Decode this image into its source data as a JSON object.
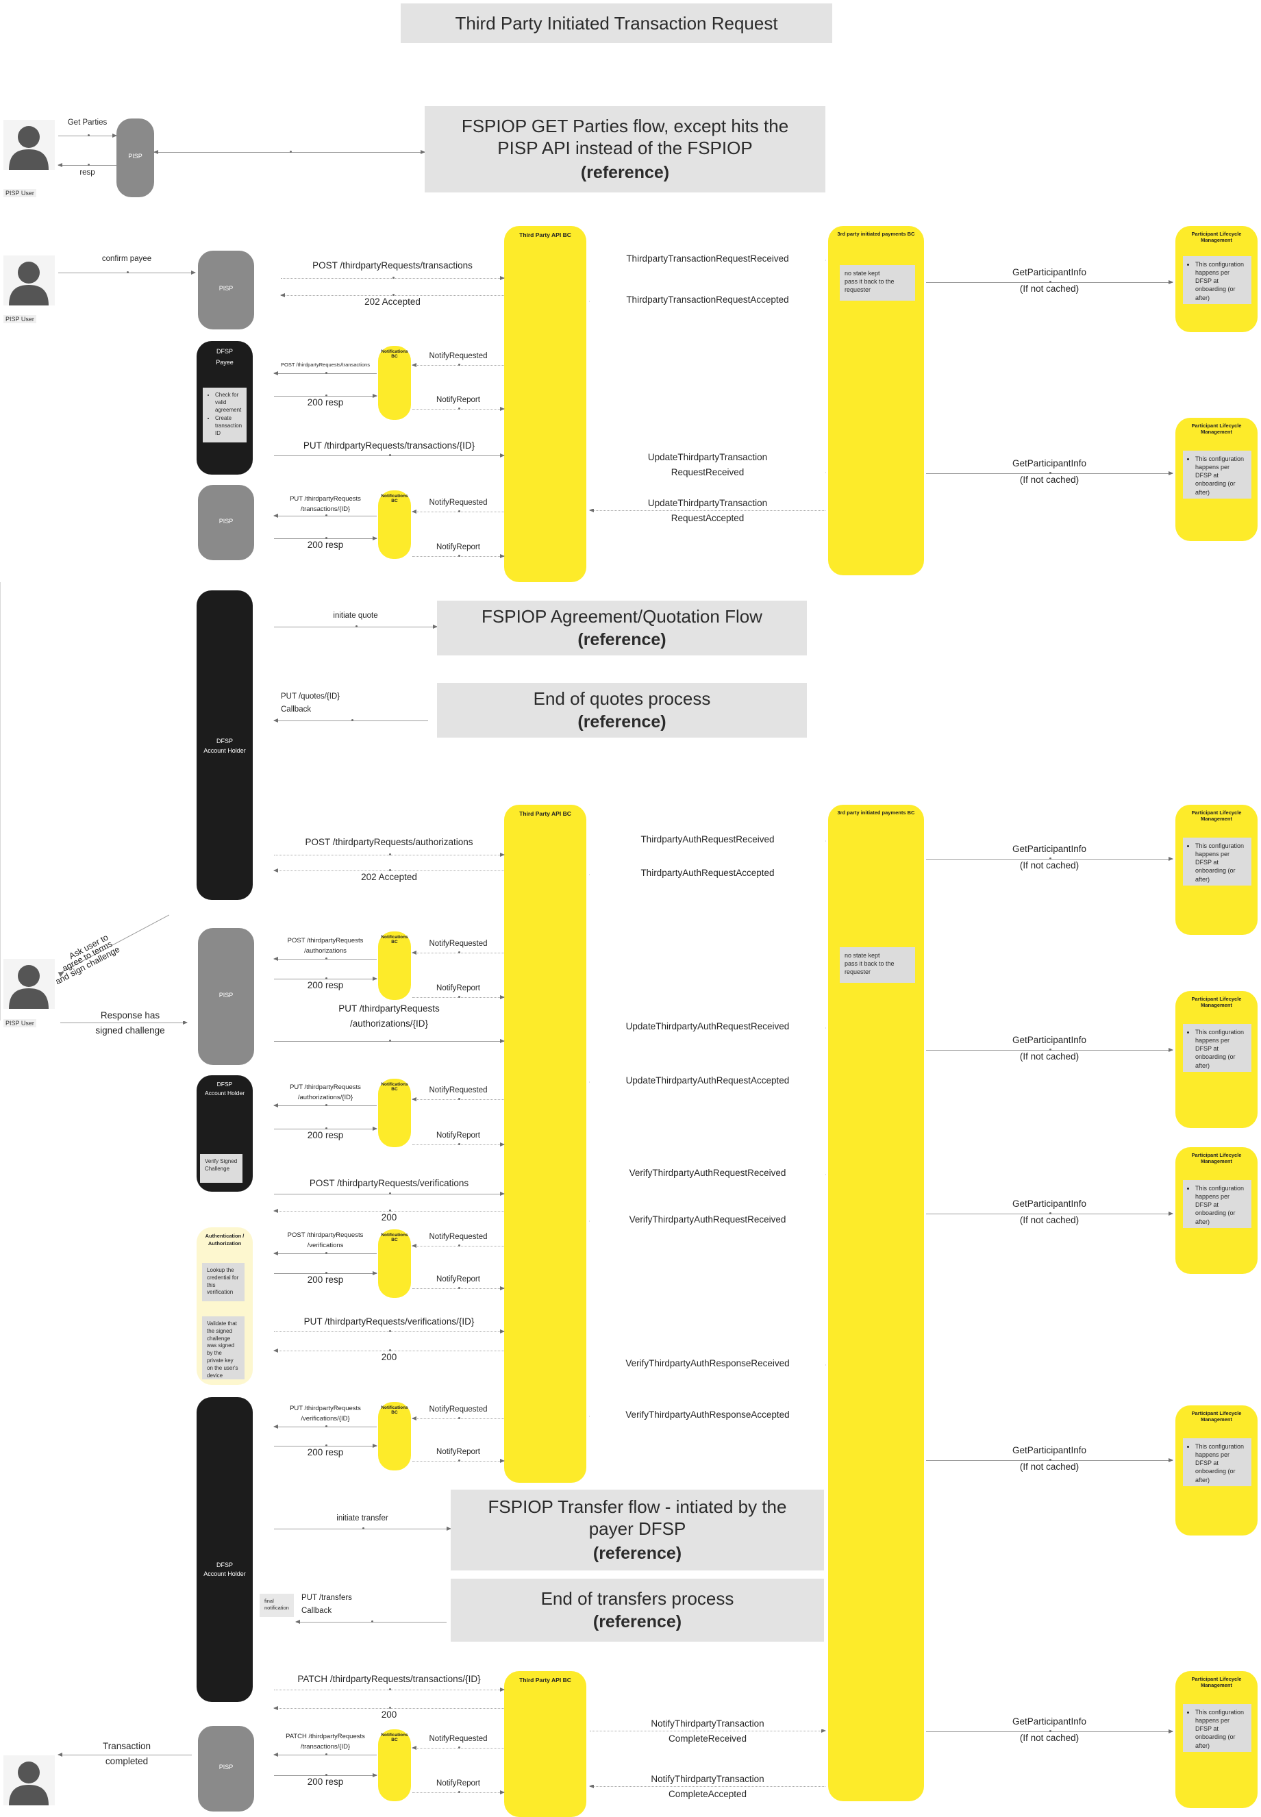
{
  "title": "Third Party Initiated Transaction Request",
  "actors": {
    "pisp_user": "PISP User",
    "pisp": "PISP",
    "dfsp_payee_l1": "DFSP",
    "dfsp_payee_l2": "Payee",
    "dfsp_account_l1": "DFSP",
    "dfsp_account_l2": "Account Holder",
    "third_party_api_bc": "Third Party API BC",
    "third_party_payments_bc": "3rd party initiated payments BC",
    "notifications_bc": "Notifications BC",
    "participant_lifecycle": "Participant Lifecycle Management",
    "auth_service_l1": "Authentication /",
    "auth_service_l2": "Authorization"
  },
  "notes": {
    "no_state_kept": "no state kept\npass it back to the requester",
    "plm_config": "This configuration happens per DFSP at onboarding (or after)",
    "payee_checks_1": "Check for valid agreement",
    "payee_checks_2": "Create transaction ID",
    "verify_signed_challenge": "Verify Signed\nChallenge",
    "lookup_credential": "Lookup the credential for this verification",
    "validate_signed": "Validate that the signed challenge was signed by the private key on the user's device",
    "final_notification": "final\nnotification"
  },
  "reference_boxes": [
    {
      "id": "get-parties",
      "line1": "FSPIOP GET Parties flow, except hits the PISP API instead of the FSPIOP",
      "line2": "(reference)"
    },
    {
      "id": "agreement-quotation",
      "line1": "FSPIOP Agreement/Quotation Flow",
      "line2": "(reference)"
    },
    {
      "id": "end-of-quotes",
      "line1": "End of quotes process",
      "line2": "(reference)"
    },
    {
      "id": "fspiop-transfer",
      "line1": "FSPIOP Transfer flow - intiated by the payer DFSP",
      "line2": "(reference)"
    },
    {
      "id": "end-of-transfers",
      "line1": "End of transfers process",
      "line2": "(reference)"
    }
  ],
  "messages": {
    "get_parties": "Get Parties",
    "resp": "resp",
    "confirm_payee": "confirm payee",
    "post_ttr_transactions": "POST /thirdpartyRequests/transactions",
    "accepted_202": "202 Accepted",
    "ttr_received": "ThirdpartyTransactionRequestReceived",
    "ttr_accepted": "ThirdpartyTransactionRequestAccepted",
    "get_participant_info_l1": "GetParticipantInfo",
    "get_participant_info_l2": "(If not cached)",
    "post_ttr_transactions_small": "POST /thirdpartyRequests/transactions",
    "resp_200": "200 resp",
    "notify_requested": "NotifyRequested",
    "notify_report": "NotifyReport",
    "put_ttr_transactions_id": "PUT /thirdpartyRequests/transactions/{ID}",
    "update_ttr_received_l1": "UpdateThirdpartyTransaction",
    "update_ttr_received_l2": "RequestReceived",
    "update_ttr_accepted_l1": "UpdateThirdpartyTransaction",
    "update_ttr_accepted_l2": "RequestAccepted",
    "put_ttr_transactions_l1": "PUT /thirdpartyRequests",
    "put_ttr_transactions_l2": "/transactions/{ID}",
    "initiate_quote": "initiate quote",
    "put_quotes_l1": "PUT /quotes/{ID}",
    "put_quotes_l2": "Callback",
    "post_ttr_authorizations": "POST /thirdpartyRequests/authorizations",
    "tp_auth_req_received": "ThirdpartyAuthRequestReceived",
    "tp_auth_req_accepted": "ThirdpartyAuthRequestAccepted",
    "ask_user_l1": "Ask user to",
    "ask_user_l2": "agree to terms",
    "ask_user_l3": "and sign challenge",
    "response_signed_l1": "Response has",
    "response_signed_l2": "signed challenge",
    "post_ttr_auth_l1": "POST /thirdpartyRequests",
    "post_ttr_auth_l2": "/authorizations",
    "put_ttr_auth_l1": "PUT /thirdpartyRequests",
    "put_ttr_auth_l2": "/authorizations/{ID}",
    "update_tp_auth_received": "UpdateThirdpartyAuthRequestReceived",
    "update_tp_auth_accepted": "UpdateThirdpartyAuthRequestAccepted",
    "post_ttr_verifications": "POST /thirdpartyRequests/verifications",
    "r_200": "200",
    "verify_tp_auth_req_received": "VerifyThirdpartyAuthRequestReceived",
    "verify_tp_auth_req_received2": "VerifyThirdpartyAuthRequestReceived",
    "post_ttr_verif_l1": "POST /thirdpartyRequests",
    "post_ttr_verif_l2": "/verifications",
    "put_ttr_verifications_id": "PUT /thirdpartyRequests/verifications/{ID}",
    "verify_tp_auth_resp_received": "VerifyThirdpartyAuthResponseReceived",
    "verify_tp_auth_resp_accepted": "VerifyThirdpartyAuthResponseAccepted",
    "put_ttr_verif_l1": "PUT /thirdpartyRequests",
    "put_ttr_verif_l2": "/verifications/{ID}",
    "initiate_transfer": "initiate transfer",
    "put_transfers_l1": "PUT /transfers",
    "put_transfers_l2": "Callback",
    "patch_ttr_transactions_id": "PATCH /thirdpartyRequests/transactions/{ID}",
    "patch_ttr_l1": "PATCH /thirdpartyRequests",
    "patch_ttr_l2": "/transactions/{ID}",
    "notify_tp_complete_received_l1": "NotifyThirdpartyTransaction",
    "notify_tp_complete_received_l2": "CompleteReceived",
    "notify_tp_complete_accepted_l1": "NotifyThirdpartyTransaction",
    "notify_tp_complete_accepted_l2": "CompleteAccepted",
    "transaction_completed_l1": "Transaction",
    "transaction_completed_l2": "completed"
  },
  "colors": {
    "yellow": "#fdeb2a",
    "grey_actor": "#8a8a8a",
    "black_actor": "#1c1c1c",
    "banner_grey": "#e3e3e3",
    "note_grey": "#dcdcdc",
    "cream": "#fdf7cf"
  }
}
